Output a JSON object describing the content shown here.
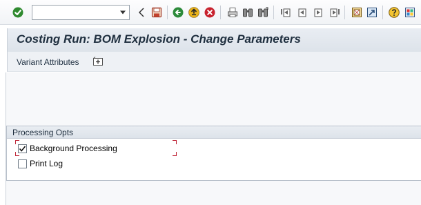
{
  "toolbar": {
    "command_field_value": "",
    "buttons": [
      {
        "id": "enter",
        "icon": "check-icon"
      },
      {
        "id": "save",
        "icon": "save-icon"
      },
      {
        "id": "back",
        "icon": "back-icon"
      },
      {
        "id": "exit",
        "icon": "exit-icon"
      },
      {
        "id": "cancel",
        "icon": "cancel-icon"
      },
      {
        "id": "print",
        "icon": "print-icon"
      },
      {
        "id": "find",
        "icon": "find-icon"
      },
      {
        "id": "find-next",
        "icon": "find-next-icon"
      },
      {
        "id": "first-page",
        "icon": "first-page-icon"
      },
      {
        "id": "previous-page",
        "icon": "previous-page-icon"
      },
      {
        "id": "next-page",
        "icon": "next-page-icon"
      },
      {
        "id": "last-page",
        "icon": "last-page-icon"
      },
      {
        "id": "new-session",
        "icon": "new-session-icon"
      },
      {
        "id": "shortcut",
        "icon": "shortcut-icon"
      },
      {
        "id": "help",
        "icon": "help-icon"
      },
      {
        "id": "layout",
        "icon": "customize-layout-icon"
      }
    ]
  },
  "title": "Costing Run: BOM Explosion - Change Parameters",
  "app_toolbar": {
    "variant_attributes_label": "Variant Attributes"
  },
  "processing_group": {
    "title": "Processing Opts",
    "options": [
      {
        "label": "Background Processing",
        "checked": true
      },
      {
        "label": "Print Log",
        "checked": false
      }
    ]
  },
  "colors": {
    "title_text": "#1f2f3f",
    "focus_marker": "#c0283a",
    "enter_green": "#2f8a2f",
    "nav_green": "#2c8a3a",
    "exit_yellow": "#e8b21c",
    "cancel_red": "#c8222e"
  }
}
